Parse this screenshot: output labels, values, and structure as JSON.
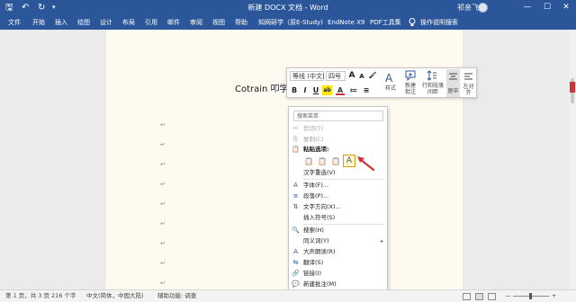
{
  "titlebar": {
    "title": "新建 DOCX 文档 - Word",
    "user_name": "祁亲飞",
    "save_glyph": "🖫",
    "undo_glyph": "↶",
    "redo_glyph": "↻",
    "more_glyph": "▾",
    "window_controls": {
      "minimize": "—",
      "maximize": "☐",
      "close": "✕"
    }
  },
  "ribbon": {
    "tabs": [
      "文件",
      "开始",
      "插入",
      "绘图",
      "设计",
      "布局",
      "引用",
      "邮件",
      "审阅",
      "视图",
      "帮助",
      "知网研学（原E-Study)",
      "EndNote X9",
      "PDF工具集"
    ],
    "tell_me": "操作说明搜索"
  },
  "document": {
    "paragraph_mark": "↵",
    "text_before": "Cotrain ",
    "text_selected": "叩学",
    "cursor": "|"
  },
  "mini_toolbar": {
    "font_name": "等线 (中文)",
    "font_size": "四号",
    "grow": "A",
    "shrink": "A",
    "format_painter_glyph": "🖌",
    "bold": "B",
    "italic": "I",
    "underline": "U",
    "highlight_glyph": "ab",
    "font_color_glyph": "A",
    "bullets_glyph": "≔",
    "numbering_glyph": "≡",
    "styles_label": "样式",
    "new_comment_label": "新建\n批注",
    "line_spacing_label": "行和段落\n间距",
    "center_label": "居中",
    "left_align_label": "左对\n齐"
  },
  "context_menu": {
    "search_placeholder": "搜索菜单",
    "items": [
      {
        "label": "剪切(T)",
        "icon": "✂",
        "disabled": true
      },
      {
        "label": "复制(C)",
        "icon": "⎘",
        "disabled": true
      },
      {
        "label": "粘贴选项:",
        "icon": "📋",
        "disabled": false,
        "bold": true
      },
      {
        "label": "汉字重选(V)",
        "icon": "",
        "disabled": false
      },
      {
        "label": "字体(F)...",
        "icon": "A",
        "disabled": false
      },
      {
        "label": "段落(P)...",
        "icon": "≡",
        "disabled": false
      },
      {
        "label": "文字方向(X)...",
        "icon": "⇅",
        "disabled": false
      },
      {
        "label": "插入符号(S)",
        "icon": "",
        "disabled": false
      },
      {
        "label": "搜索(H)",
        "icon": "🔍",
        "disabled": false
      },
      {
        "label": "同义词(Y)",
        "icon": "",
        "disabled": false,
        "submenu": true
      },
      {
        "label": "大声朗读(R)",
        "icon": "A",
        "disabled": false
      },
      {
        "label": "翻译(S)",
        "icon": "⇆",
        "disabled": false
      },
      {
        "label": "链接(I)",
        "icon": "🔗",
        "disabled": false
      },
      {
        "label": "新建批注(M)",
        "icon": "💬",
        "disabled": false
      }
    ],
    "paste_options": [
      {
        "glyph": "📋",
        "name": "keep-source-formatting"
      },
      {
        "glyph": "📋",
        "name": "merge-formatting"
      },
      {
        "glyph": "📋",
        "name": "picture"
      },
      {
        "glyph": "A",
        "name": "keep-text-only"
      }
    ],
    "submenu_arrow": "▸"
  },
  "statusbar": {
    "page": "第 1 页，共 3 页",
    "words": "216 个字",
    "language": "中文(简体，中国大陆)",
    "accessibility": "辅助功能: 调查",
    "zoom_minus": "—",
    "zoom_plus": "+"
  },
  "colors": {
    "accent": "#2b579a",
    "page_bg": "#fffaf0",
    "annotation_red": "#d13438"
  }
}
